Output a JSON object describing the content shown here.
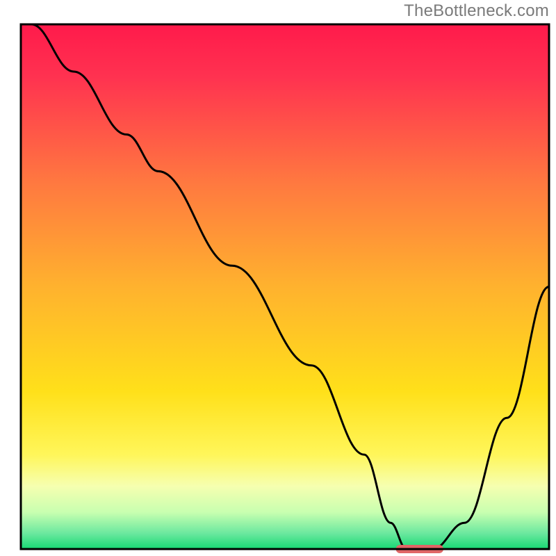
{
  "watermark": "TheBottleneck.com",
  "chart_data": {
    "type": "line",
    "title": "",
    "xlabel": "",
    "ylabel": "",
    "xlim": [
      0,
      100
    ],
    "ylim": [
      0,
      100
    ],
    "grid": false,
    "legend": false,
    "x": [
      2,
      10,
      20,
      26,
      40,
      55,
      65,
      70,
      73,
      78,
      84,
      92,
      100
    ],
    "y": [
      100,
      91,
      79,
      72,
      54,
      35,
      18,
      5,
      0,
      0,
      5,
      25,
      50
    ],
    "highlight_segment": {
      "x_start": 71,
      "x_end": 80,
      "y": 0
    },
    "axes_visible": false
  },
  "gradient": {
    "stops": [
      {
        "offset": 0.0,
        "color": "#ff1a4b"
      },
      {
        "offset": 0.1,
        "color": "#ff3250"
      },
      {
        "offset": 0.3,
        "color": "#ff7840"
      },
      {
        "offset": 0.5,
        "color": "#ffb22e"
      },
      {
        "offset": 0.7,
        "color": "#ffe01a"
      },
      {
        "offset": 0.82,
        "color": "#fff65a"
      },
      {
        "offset": 0.88,
        "color": "#f6ffb0"
      },
      {
        "offset": 0.93,
        "color": "#c8ffb0"
      },
      {
        "offset": 0.97,
        "color": "#6be89f"
      },
      {
        "offset": 1.0,
        "color": "#17d873"
      }
    ]
  },
  "plot": {
    "margin_top": 35,
    "margin_left": 30,
    "margin_right": 10,
    "margin_bottom": 10,
    "border_color": "#000000",
    "border_width": 3,
    "curve_color": "#000000",
    "curve_width": 3,
    "highlight_color": "#e06666",
    "highlight_height": 12,
    "highlight_radius": 6
  }
}
